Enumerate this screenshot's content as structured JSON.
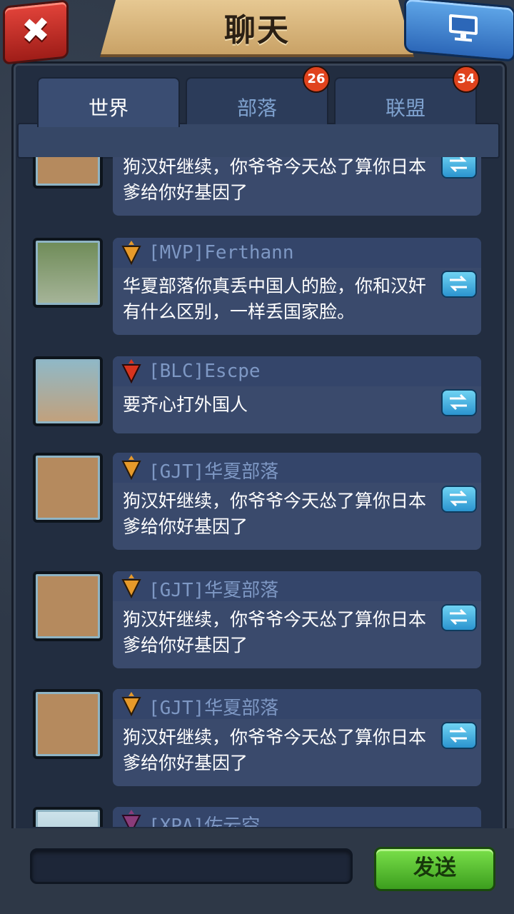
{
  "header": {
    "title": "聊天"
  },
  "tabs": [
    {
      "label": "世界",
      "badge": ""
    },
    {
      "label": "部落",
      "badge": "26"
    },
    {
      "label": "联盟",
      "badge": "34"
    }
  ],
  "messages": [
    {
      "name": "",
      "text": "狗汉奸继续，你爷爷今天怂了算你日本爹给你好基因了",
      "rank_color": "#e79a2a"
    },
    {
      "name": "[MVP]Ferthann",
      "text": "华夏部落你真丢中国人的脸，你和汉奸有什么区别，一样丢国家脸。",
      "rank_color": "#e79a2a"
    },
    {
      "name": "[BLC]Escpe",
      "text": "要齐心打外国人",
      "rank_color": "#d8341e"
    },
    {
      "name": "[GJT]华夏部落",
      "text": "狗汉奸继续，你爷爷今天怂了算你日本爹给你好基因了",
      "rank_color": "#e79a2a"
    },
    {
      "name": "[GJT]华夏部落",
      "text": "狗汉奸继续，你爷爷今天怂了算你日本爹给你好基因了",
      "rank_color": "#e79a2a"
    },
    {
      "name": "[GJT]华夏部落",
      "text": "狗汉奸继续，你爷爷今天怂了算你日本爹给你好基因了",
      "rank_color": "#e79a2a"
    },
    {
      "name": "[XPA]佐云空",
      "text": "",
      "rank_color": "#8a3c7a"
    }
  ],
  "input": {
    "value": "",
    "placeholder": ""
  },
  "send_label": "发送",
  "icons": {
    "close": "close-icon",
    "screen": "monitor-icon",
    "share": "share-arrows-icon",
    "rank": "rank-shield-icon"
  }
}
